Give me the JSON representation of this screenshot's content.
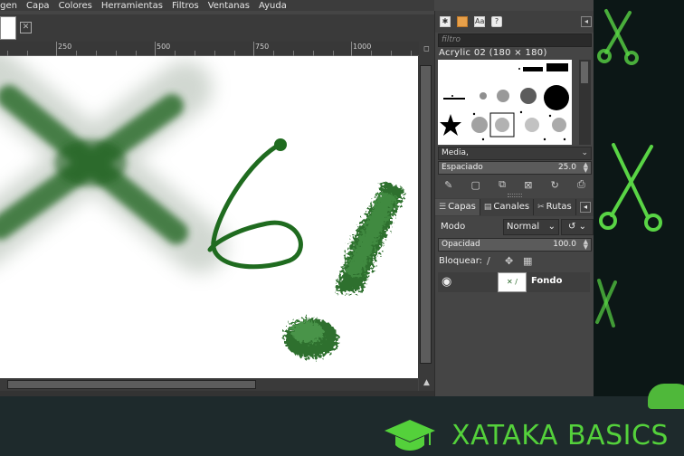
{
  "menubar": {
    "items": [
      "agen",
      "Capa",
      "Colores",
      "Herramientas",
      "Filtros",
      "Ventanas",
      "Ayuda"
    ]
  },
  "image_tab": {
    "close_icon": "close-icon"
  },
  "ruler": {
    "labels": [
      "250",
      "500",
      "750",
      "1000"
    ]
  },
  "brushes": {
    "filter_placeholder": "filtro",
    "selected_brush": "Acrylic 02 (180 × 180)",
    "tag_combo": "Media,",
    "spacing_label": "Espaciado",
    "spacing_value": "25.0"
  },
  "layers_panel": {
    "tabs": [
      "Capas",
      "Canales",
      "Rutas"
    ],
    "mode_label": "Modo",
    "mode_value": "Normal",
    "opacity_label": "Opacidad",
    "opacity_value": "100.0",
    "lock_label": "Bloquear:",
    "layers": [
      {
        "name": "Fondo"
      }
    ]
  },
  "footer": {
    "brand": "XATAKA BASICS",
    "brand_color": "#54d13b"
  },
  "colors": {
    "ink": "#1f6b1f",
    "app_bg": "#454545",
    "deco_green": "#59d445"
  }
}
